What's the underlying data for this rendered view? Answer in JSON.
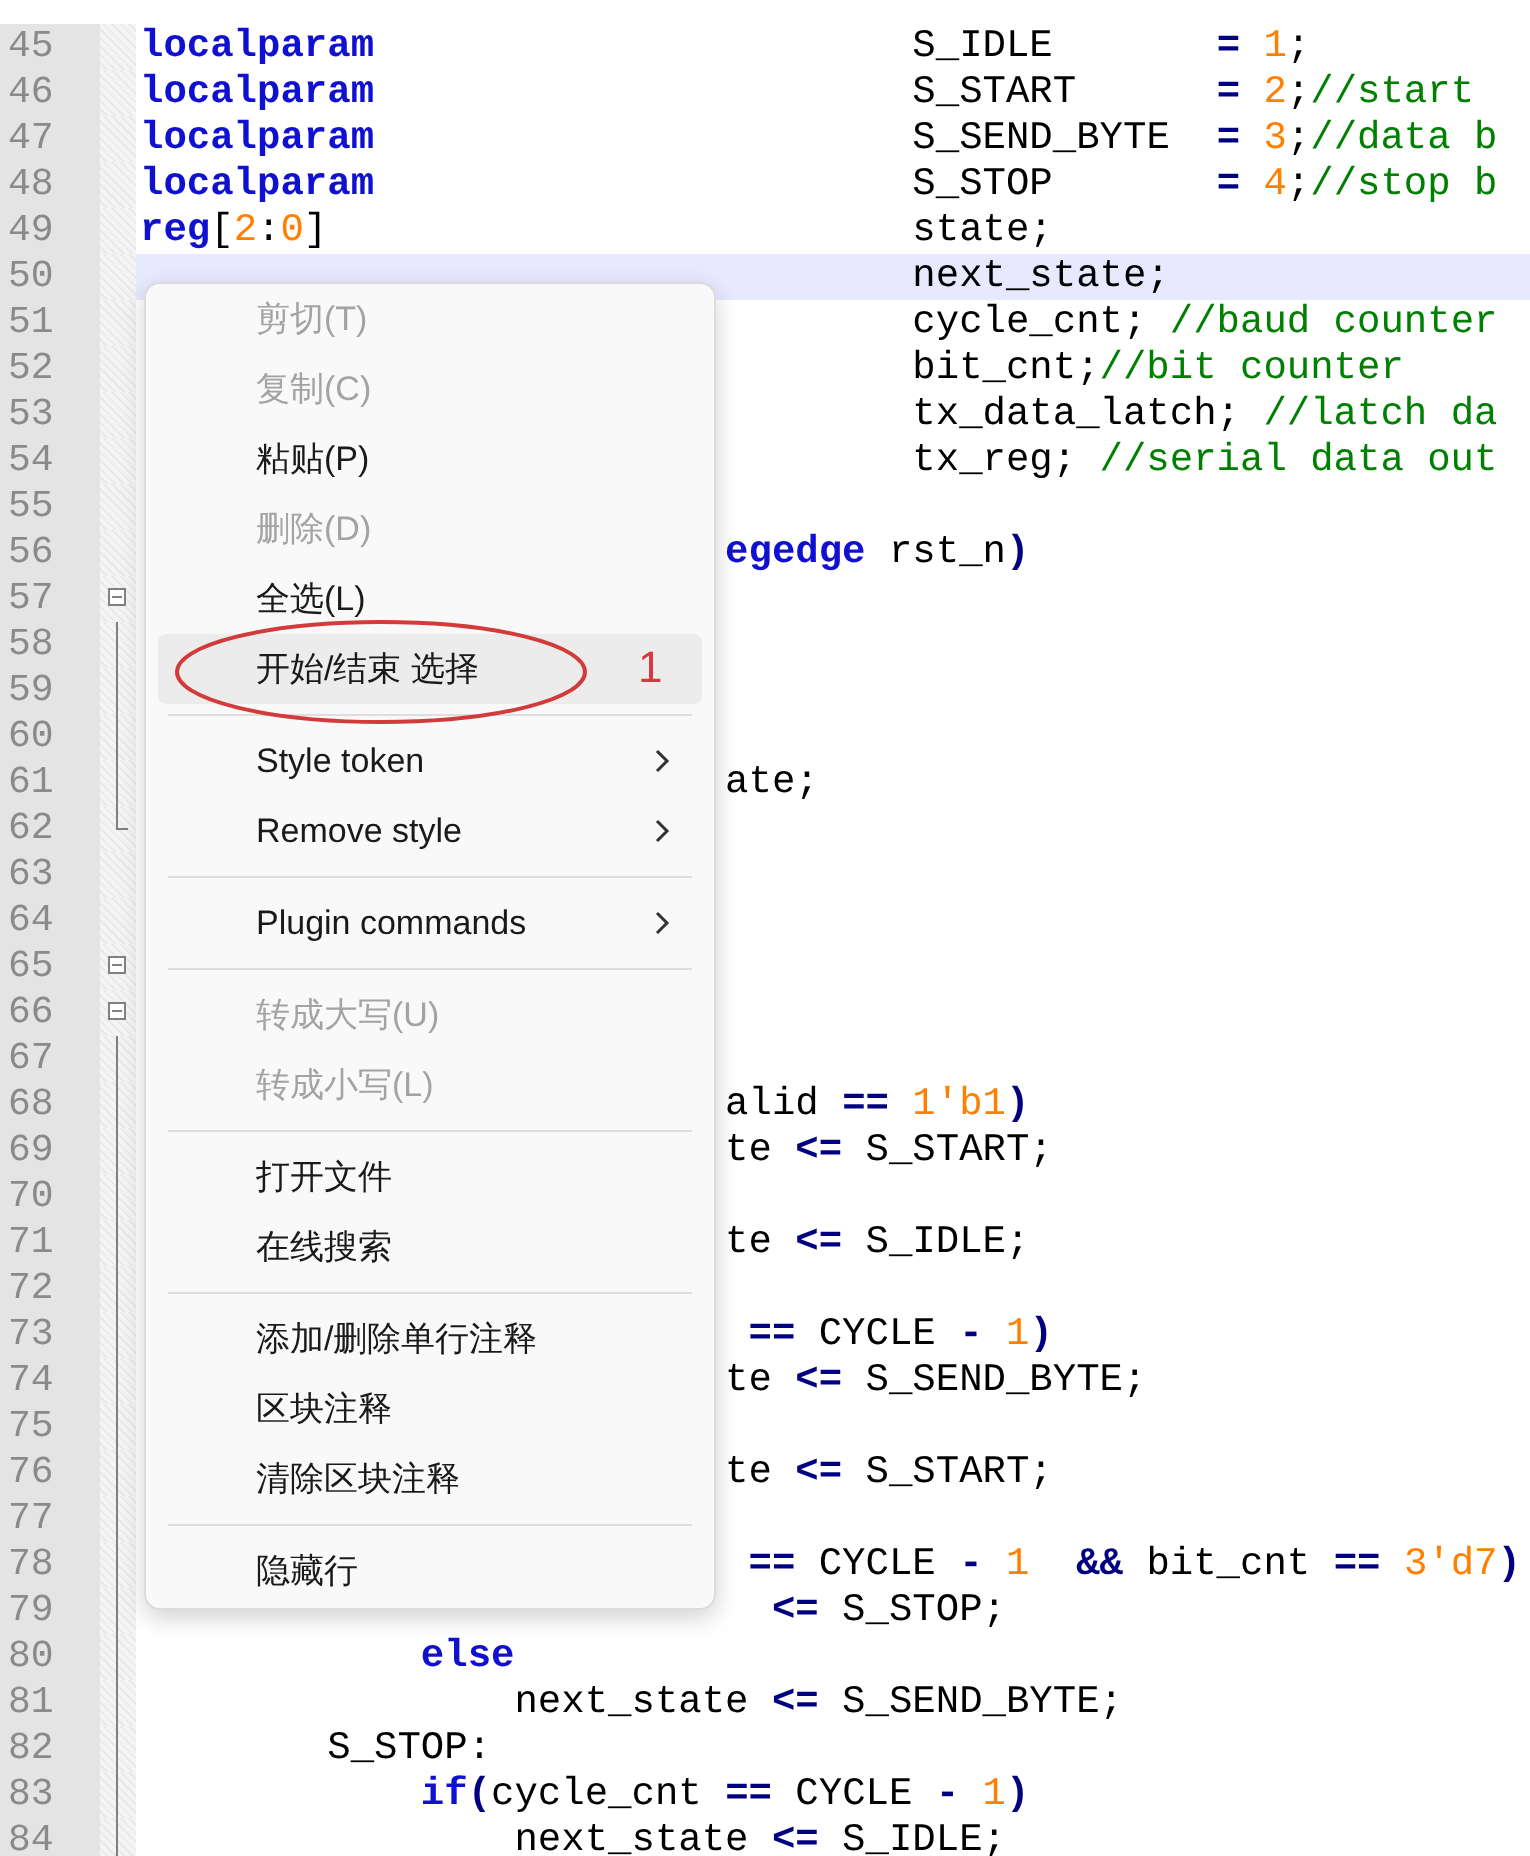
{
  "editor": {
    "lines": [
      {
        "number": "45",
        "current": false,
        "tokens": [
          {
            "kind": "kw",
            "text": "localparam"
          },
          {
            "kind": "txt",
            "text": "                       S_IDLE       "
          },
          {
            "kind": "op",
            "text": "= "
          },
          {
            "kind": "num",
            "text": "1"
          },
          {
            "kind": "txt",
            "text": ";"
          }
        ]
      },
      {
        "number": "46",
        "current": false,
        "tokens": [
          {
            "kind": "kw",
            "text": "localparam"
          },
          {
            "kind": "txt",
            "text": "                       S_START      "
          },
          {
            "kind": "op",
            "text": "= "
          },
          {
            "kind": "num",
            "text": "2"
          },
          {
            "kind": "txt",
            "text": ";"
          },
          {
            "kind": "com",
            "text": "//start"
          }
        ]
      },
      {
        "number": "47",
        "current": false,
        "tokens": [
          {
            "kind": "kw",
            "text": "localparam"
          },
          {
            "kind": "txt",
            "text": "                       S_SEND_BYTE  "
          },
          {
            "kind": "op",
            "text": "= "
          },
          {
            "kind": "num",
            "text": "3"
          },
          {
            "kind": "txt",
            "text": ";"
          },
          {
            "kind": "com",
            "text": "//data b"
          }
        ]
      },
      {
        "number": "48",
        "current": false,
        "tokens": [
          {
            "kind": "kw",
            "text": "localparam"
          },
          {
            "kind": "txt",
            "text": "                       S_STOP       "
          },
          {
            "kind": "op",
            "text": "= "
          },
          {
            "kind": "num",
            "text": "4"
          },
          {
            "kind": "txt",
            "text": ";"
          },
          {
            "kind": "com",
            "text": "//stop b"
          }
        ]
      },
      {
        "number": "49",
        "current": false,
        "tokens": [
          {
            "kind": "kw",
            "text": "reg"
          },
          {
            "kind": "txt",
            "text": "["
          },
          {
            "kind": "num",
            "text": "2"
          },
          {
            "kind": "txt",
            "text": ":"
          },
          {
            "kind": "num",
            "text": "0"
          },
          {
            "kind": "txt",
            "text": "]                         state;"
          }
        ]
      },
      {
        "number": "50",
        "current": true,
        "tokens": [
          {
            "kind": "txt",
            "text": "                                 next_state;"
          }
        ]
      },
      {
        "number": "51",
        "current": false,
        "tokens": [
          {
            "kind": "txt",
            "text": "                                 cycle_cnt; "
          },
          {
            "kind": "com",
            "text": "//baud counter"
          }
        ]
      },
      {
        "number": "52",
        "current": false,
        "tokens": [
          {
            "kind": "txt",
            "text": "                                 bit_cnt;"
          },
          {
            "kind": "com",
            "text": "//bit counter"
          }
        ]
      },
      {
        "number": "53",
        "current": false,
        "tokens": [
          {
            "kind": "txt",
            "text": "                                 tx_data_latch; "
          },
          {
            "kind": "com",
            "text": "//latch da"
          }
        ]
      },
      {
        "number": "54",
        "current": false,
        "tokens": [
          {
            "kind": "txt",
            "text": "                                 tx_reg; "
          },
          {
            "kind": "com",
            "text": "//serial data out"
          }
        ]
      },
      {
        "number": "55",
        "current": false
      },
      {
        "number": "56",
        "current": false,
        "tokens": [
          {
            "kind": "kw",
            "text": "                         egedge"
          },
          {
            "kind": "txt",
            "text": " rst_n"
          },
          {
            "kind": "op",
            "text": ")"
          }
        ]
      },
      {
        "number": "57",
        "current": false,
        "fold_box": true
      },
      {
        "number": "58",
        "current": false,
        "fold_line": true
      },
      {
        "number": "59",
        "current": false,
        "fold_line": true
      },
      {
        "number": "60",
        "current": false,
        "fold_line": true
      },
      {
        "number": "61",
        "current": false,
        "fold_line": true,
        "tokens": [
          {
            "kind": "txt",
            "text": "                         ate;"
          }
        ]
      },
      {
        "number": "62",
        "current": false,
        "fold_end": true
      },
      {
        "number": "63",
        "current": false
      },
      {
        "number": "64",
        "current": false
      },
      {
        "number": "65",
        "current": false,
        "fold_box": true
      },
      {
        "number": "66",
        "current": false,
        "fold_box": true
      },
      {
        "number": "67",
        "current": false,
        "fold_line": true
      },
      {
        "number": "68",
        "current": false,
        "fold_line": true,
        "tokens": [
          {
            "kind": "txt",
            "text": "                         alid "
          },
          {
            "kind": "op",
            "text": "== "
          },
          {
            "kind": "num",
            "text": "1'b1"
          },
          {
            "kind": "op",
            "text": ")"
          }
        ]
      },
      {
        "number": "69",
        "current": false,
        "fold_line": true,
        "tokens": [
          {
            "kind": "txt",
            "text": "                         te "
          },
          {
            "kind": "op",
            "text": "<="
          },
          {
            "kind": "txt",
            "text": " S_START;"
          }
        ]
      },
      {
        "number": "70",
        "current": false,
        "fold_line": true
      },
      {
        "number": "71",
        "current": false,
        "fold_line": true,
        "tokens": [
          {
            "kind": "txt",
            "text": "                         te "
          },
          {
            "kind": "op",
            "text": "<="
          },
          {
            "kind": "txt",
            "text": " S_IDLE;"
          }
        ]
      },
      {
        "number": "72",
        "current": false,
        "fold_line": true
      },
      {
        "number": "73",
        "current": false,
        "fold_line": true,
        "tokens": [
          {
            "kind": "op",
            "text": "                          =="
          },
          {
            "kind": "txt",
            "text": " CYCLE "
          },
          {
            "kind": "op",
            "text": "- "
          },
          {
            "kind": "num",
            "text": "1"
          },
          {
            "kind": "op",
            "text": ")"
          }
        ]
      },
      {
        "number": "74",
        "current": false,
        "fold_line": true,
        "tokens": [
          {
            "kind": "txt",
            "text": "                         te "
          },
          {
            "kind": "op",
            "text": "<="
          },
          {
            "kind": "txt",
            "text": " S_SEND_BYTE;"
          }
        ]
      },
      {
        "number": "75",
        "current": false,
        "fold_line": true
      },
      {
        "number": "76",
        "current": false,
        "fold_line": true,
        "tokens": [
          {
            "kind": "txt",
            "text": "                         te "
          },
          {
            "kind": "op",
            "text": "<="
          },
          {
            "kind": "txt",
            "text": " S_START;"
          }
        ]
      },
      {
        "number": "77",
        "current": false,
        "fold_line": true
      },
      {
        "number": "78",
        "current": false,
        "fold_line": true,
        "tokens": [
          {
            "kind": "op",
            "text": "                          =="
          },
          {
            "kind": "txt",
            "text": " CYCLE "
          },
          {
            "kind": "op",
            "text": "- "
          },
          {
            "kind": "num",
            "text": "1"
          },
          {
            "kind": "op",
            "text": "  &&"
          },
          {
            "kind": "txt",
            "text": " bit_cnt "
          },
          {
            "kind": "op",
            "text": "== "
          },
          {
            "kind": "num",
            "text": "3'd7"
          },
          {
            "kind": "op",
            "text": ")"
          }
        ]
      },
      {
        "number": "79",
        "current": false,
        "fold_line": true,
        "tokens": [
          {
            "kind": "op",
            "text": "                           <="
          },
          {
            "kind": "txt",
            "text": " S_STOP;"
          }
        ]
      },
      {
        "number": "80",
        "current": false,
        "fold_line": true,
        "tokens": [
          {
            "kind": "kw",
            "text": "            else"
          }
        ]
      },
      {
        "number": "81",
        "current": false,
        "fold_line": true,
        "tokens": [
          {
            "kind": "txt",
            "text": "                next_state "
          },
          {
            "kind": "op",
            "text": "<="
          },
          {
            "kind": "txt",
            "text": " S_SEND_BYTE;"
          }
        ]
      },
      {
        "number": "82",
        "current": false,
        "fold_line": true,
        "tokens": [
          {
            "kind": "txt",
            "text": "        S_STOP:"
          }
        ]
      },
      {
        "number": "83",
        "current": false,
        "fold_line": true,
        "tokens": [
          {
            "kind": "kw",
            "text": "            if"
          },
          {
            "kind": "op",
            "text": "("
          },
          {
            "kind": "txt",
            "text": "cycle_cnt "
          },
          {
            "kind": "op",
            "text": "=="
          },
          {
            "kind": "txt",
            "text": " CYCLE "
          },
          {
            "kind": "op",
            "text": "- "
          },
          {
            "kind": "num",
            "text": "1"
          },
          {
            "kind": "op",
            "text": ")"
          }
        ]
      },
      {
        "number": "84",
        "current": false,
        "fold_line": true,
        "tokens": [
          {
            "kind": "txt",
            "text": "                next_state "
          },
          {
            "kind": "op",
            "text": "<="
          },
          {
            "kind": "txt",
            "text": " S_IDLE;"
          }
        ]
      }
    ]
  },
  "context_menu": {
    "items": [
      {
        "kind": "item",
        "label": "剪切(T)",
        "disabled": true,
        "selected": false,
        "submenu": false
      },
      {
        "kind": "item",
        "label": "复制(C)",
        "disabled": true,
        "selected": false,
        "submenu": false
      },
      {
        "kind": "item",
        "label": "粘贴(P)",
        "disabled": false,
        "selected": false,
        "submenu": false
      },
      {
        "kind": "item",
        "label": "删除(D)",
        "disabled": true,
        "selected": false,
        "submenu": false
      },
      {
        "kind": "item",
        "label": "全选(L)",
        "disabled": false,
        "selected": false,
        "submenu": false
      },
      {
        "kind": "item",
        "label": "开始/结束 选择",
        "disabled": false,
        "selected": true,
        "submenu": false,
        "circled": true,
        "note": "1"
      },
      {
        "kind": "separator"
      },
      {
        "kind": "item",
        "label": "Style token",
        "disabled": false,
        "selected": false,
        "submenu": true
      },
      {
        "kind": "item",
        "label": "Remove style",
        "disabled": false,
        "selected": false,
        "submenu": true
      },
      {
        "kind": "separator"
      },
      {
        "kind": "item",
        "label": "Plugin commands",
        "disabled": false,
        "selected": false,
        "submenu": true
      },
      {
        "kind": "separator"
      },
      {
        "kind": "item",
        "label": "转成大写(U)",
        "disabled": true,
        "selected": false,
        "submenu": false
      },
      {
        "kind": "item",
        "label": "转成小写(L)",
        "disabled": true,
        "selected": false,
        "submenu": false
      },
      {
        "kind": "separator"
      },
      {
        "kind": "item",
        "label": "打开文件",
        "disabled": false,
        "selected": false,
        "submenu": false
      },
      {
        "kind": "item",
        "label": "在线搜索",
        "disabled": false,
        "selected": false,
        "submenu": false
      },
      {
        "kind": "separator"
      },
      {
        "kind": "item",
        "label": "添加/删除单行注释",
        "disabled": false,
        "selected": false,
        "submenu": false
      },
      {
        "kind": "item",
        "label": "区块注释",
        "disabled": false,
        "selected": false,
        "submenu": false
      },
      {
        "kind": "item",
        "label": "清除区块注释",
        "disabled": false,
        "selected": false,
        "submenu": false
      },
      {
        "kind": "separator"
      },
      {
        "kind": "item",
        "label": "隐藏行",
        "disabled": false,
        "selected": false,
        "submenu": false
      }
    ]
  }
}
